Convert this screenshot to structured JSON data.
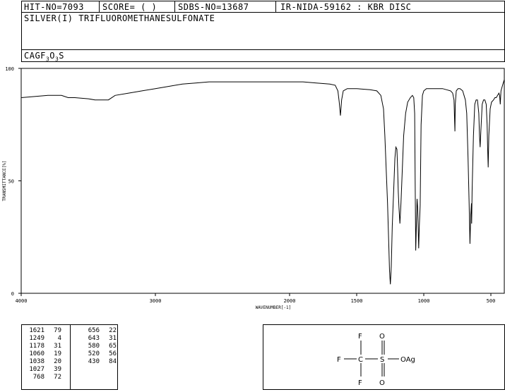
{
  "header": {
    "hit_no": "HIT-NO=7093",
    "score": "SCORE=  (  )",
    "sdbs_no": "SDBS-NO=13687",
    "ir_info": "IR-NIDA-59162 : KBR DISC"
  },
  "compound_name": "SILVER(I) TRIFLUOROMETHANESULFONATE",
  "formula": {
    "prefix": "CAGF",
    "sub1": "3",
    "mid": "O",
    "sub2": "3",
    "suffix": "S"
  },
  "chart_data": {
    "type": "line",
    "xlabel": "WAVENUMBER[-1]",
    "ylabel": "TRANSMITTANCE[%]",
    "xlim": [
      4000,
      400
    ],
    "ylim": [
      0,
      100
    ],
    "x_ticks": [
      4000,
      3000,
      2000,
      1500,
      1000,
      500
    ],
    "y_ticks": [
      0,
      50,
      100
    ],
    "grid": false,
    "series": [
      {
        "points": [
          [
            4000,
            87
          ],
          [
            3800,
            88
          ],
          [
            3700,
            88
          ],
          [
            3650,
            87
          ],
          [
            3600,
            87
          ],
          [
            3500,
            86.5
          ],
          [
            3450,
            86
          ],
          [
            3400,
            86
          ],
          [
            3350,
            86
          ],
          [
            3300,
            88
          ],
          [
            3200,
            89
          ],
          [
            3100,
            90
          ],
          [
            3000,
            91
          ],
          [
            2900,
            92
          ],
          [
            2800,
            93
          ],
          [
            2700,
            93.5
          ],
          [
            2600,
            94
          ],
          [
            2400,
            94
          ],
          [
            2200,
            94
          ],
          [
            2000,
            94
          ],
          [
            1900,
            94
          ],
          [
            1800,
            93.5
          ],
          [
            1700,
            93
          ],
          [
            1660,
            92.5
          ],
          [
            1640,
            90
          ],
          [
            1630,
            85
          ],
          [
            1621,
            79
          ],
          [
            1612,
            86
          ],
          [
            1600,
            90
          ],
          [
            1570,
            91
          ],
          [
            1500,
            91
          ],
          [
            1400,
            90.5
          ],
          [
            1350,
            90
          ],
          [
            1320,
            88
          ],
          [
            1300,
            82
          ],
          [
            1290,
            70
          ],
          [
            1280,
            55
          ],
          [
            1270,
            40
          ],
          [
            1260,
            20
          ],
          [
            1255,
            10
          ],
          [
            1249,
            4
          ],
          [
            1242,
            12
          ],
          [
            1235,
            30
          ],
          [
            1225,
            45
          ],
          [
            1215,
            60
          ],
          [
            1208,
            65
          ],
          [
            1200,
            64
          ],
          [
            1195,
            55
          ],
          [
            1190,
            45
          ],
          [
            1185,
            38
          ],
          [
            1178,
            31
          ],
          [
            1170,
            40
          ],
          [
            1160,
            55
          ],
          [
            1150,
            70
          ],
          [
            1135,
            80
          ],
          [
            1120,
            85
          ],
          [
            1100,
            87
          ],
          [
            1085,
            88
          ],
          [
            1075,
            87
          ],
          [
            1068,
            80
          ],
          [
            1064,
            50
          ],
          [
            1060,
            19
          ],
          [
            1055,
            30
          ],
          [
            1050,
            42
          ],
          [
            1045,
            38
          ],
          [
            1040,
            25
          ],
          [
            1038,
            20
          ],
          [
            1033,
            30
          ],
          [
            1027,
            39
          ],
          [
            1020,
            75
          ],
          [
            1010,
            88
          ],
          [
            1000,
            90
          ],
          [
            980,
            91
          ],
          [
            950,
            91
          ],
          [
            900,
            91
          ],
          [
            860,
            91
          ],
          [
            830,
            90.5
          ],
          [
            800,
            90
          ],
          [
            785,
            89
          ],
          [
            775,
            86
          ],
          [
            770,
            76
          ],
          [
            768,
            72
          ],
          [
            765,
            84
          ],
          [
            758,
            90
          ],
          [
            745,
            91
          ],
          [
            730,
            91
          ],
          [
            710,
            90
          ],
          [
            700,
            88
          ],
          [
            690,
            86
          ],
          [
            680,
            80
          ],
          [
            670,
            60
          ],
          [
            662,
            40
          ],
          [
            656,
            22
          ],
          [
            650,
            35
          ],
          [
            645,
            40
          ],
          [
            643,
            31
          ],
          [
            640,
            45
          ],
          [
            630,
            70
          ],
          [
            620,
            84
          ],
          [
            610,
            86
          ],
          [
            600,
            86
          ],
          [
            590,
            80
          ],
          [
            585,
            70
          ],
          [
            580,
            65
          ],
          [
            575,
            72
          ],
          [
            565,
            84
          ],
          [
            555,
            86
          ],
          [
            545,
            86
          ],
          [
            535,
            84
          ],
          [
            528,
            75
          ],
          [
            524,
            65
          ],
          [
            520,
            56
          ],
          [
            515,
            70
          ],
          [
            505,
            82
          ],
          [
            495,
            85
          ],
          [
            480,
            86
          ],
          [
            470,
            87
          ],
          [
            460,
            87
          ],
          [
            450,
            88
          ],
          [
            440,
            89
          ],
          [
            435,
            88
          ],
          [
            430,
            84
          ],
          [
            425,
            90
          ],
          [
            415,
            92
          ],
          [
            405,
            94
          ],
          [
            400,
            95
          ]
        ]
      }
    ],
    "peak_table": {
      "left": [
        [
          "1621",
          "79"
        ],
        [
          "1249",
          "4"
        ],
        [
          "1178",
          "31"
        ],
        [
          "1060",
          "19"
        ],
        [
          "1038",
          "20"
        ],
        [
          "1027",
          "39"
        ],
        [
          "768",
          "72"
        ]
      ],
      "right": [
        [
          "656",
          "22"
        ],
        [
          "643",
          "31"
        ],
        [
          "580",
          "65"
        ],
        [
          "520",
          "56"
        ],
        [
          "430",
          "84"
        ]
      ]
    }
  },
  "structure": {
    "f_top": "F",
    "f_left": "F",
    "f_bottom": "F",
    "c": "C",
    "s": "S",
    "o_top": "O",
    "o_bottom": "O",
    "oag": "OAg"
  }
}
